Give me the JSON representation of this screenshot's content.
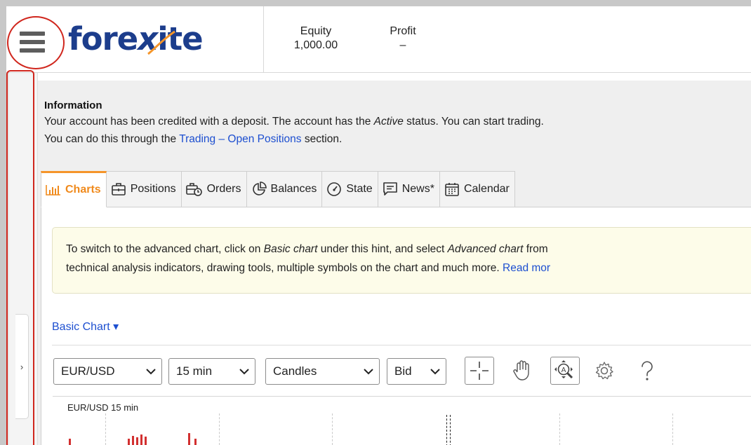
{
  "header": {
    "logo": {
      "text_left": "fore",
      "text_mid": "x",
      "text_right": "ite"
    },
    "equity": {
      "label": "Equity",
      "value": "1,000.00"
    },
    "profit": {
      "label": "Profit",
      "value": "–"
    }
  },
  "info": {
    "title": "Information",
    "line1_a": "Your account has been credited with a deposit. The account has the ",
    "line1_em": "Active",
    "line1_b": " status. You can start trading.",
    "line2_a": "You can do this through the ",
    "line2_link": "Trading – Open Positions",
    "line2_b": " section."
  },
  "tabs": [
    {
      "label": "Charts",
      "icon": "bar-chart-icon",
      "active": true
    },
    {
      "label": "Positions",
      "icon": "briefcase-icon",
      "active": false
    },
    {
      "label": "Orders",
      "icon": "clock-briefcase-icon",
      "active": false
    },
    {
      "label": "Balances",
      "icon": "pie-chart-icon",
      "active": false
    },
    {
      "label": "State",
      "icon": "gauge-icon",
      "active": false
    },
    {
      "label": "News*",
      "icon": "message-icon",
      "active": false
    },
    {
      "label": "Calendar",
      "icon": "calendar-icon",
      "active": false
    }
  ],
  "hint": {
    "l1_a": "To switch to the advanced chart, click on ",
    "l1_em1": "Basic chart",
    "l1_b": " under this hint, and select ",
    "l1_em2": "Advanced chart",
    "l1_c": " from",
    "l2_a": "technical analysis indicators, drawing tools, multiple symbols on the chart and much more. ",
    "l2_link": "Read mor"
  },
  "chart_mode": "Basic Chart ▾",
  "toolbar": {
    "pair": "EUR/USD",
    "timeframe": "15 min",
    "chart_type": "Candles",
    "price": "Bid"
  },
  "chart": {
    "caption": "EUR/USD 15 min"
  },
  "sidebar": {
    "toggle": "›"
  },
  "colors": {
    "accent": "#f5952a",
    "link": "#1d4fd0",
    "brand": "#1c3d8c",
    "highlight": "#d0261d"
  }
}
